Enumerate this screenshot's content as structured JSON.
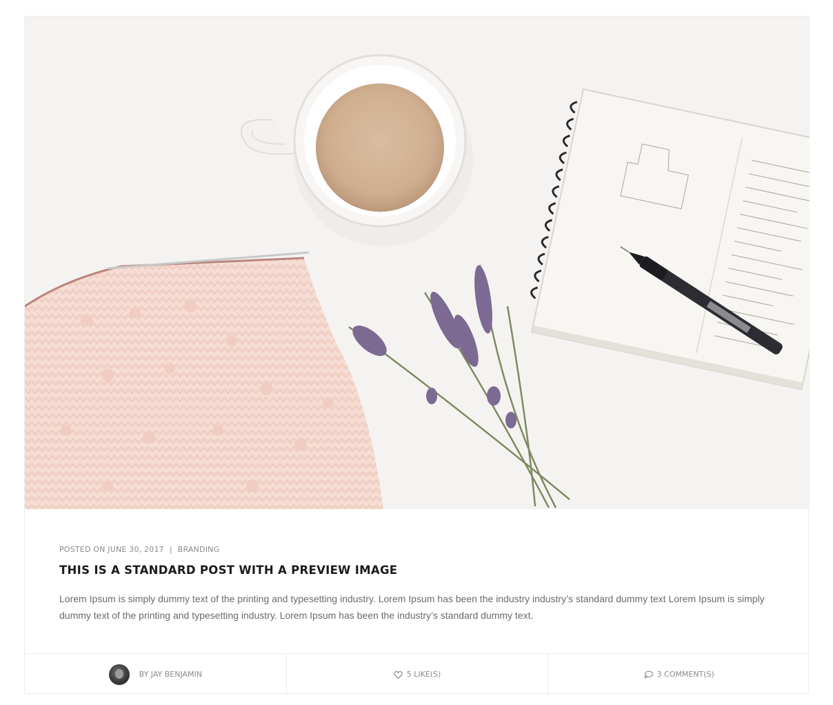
{
  "post": {
    "image_alt": "",
    "meta": {
      "posted_on": "POSTED ON JUNE 30, 2017",
      "separator": "|",
      "category": "BRANDING"
    },
    "title": "THIS IS A STANDARD POST WITH A PREVIEW IMAGE",
    "excerpt": "Lorem Ipsum is simply dummy text of the printing and typesetting industry. Lorem Ipsum has been the industry industry’s standard dummy text Lorem Ipsum is simply dummy text of the printing and typesetting industry. Lorem Ipsum has been the industry’s standard dummy text.",
    "footer": {
      "author": "BY JAY BENJAMIN",
      "likes": "5 LIKE(S)",
      "comments": "3 COMMENT(S)"
    }
  },
  "icons": {
    "likes": "heart-icon",
    "comments": "comment-bubble-icon",
    "author": "avatar"
  },
  "colors": {
    "text": "#6a6a6a",
    "title": "#1b1b1b",
    "meta": "#8a8a8a",
    "border": "#ececec"
  }
}
